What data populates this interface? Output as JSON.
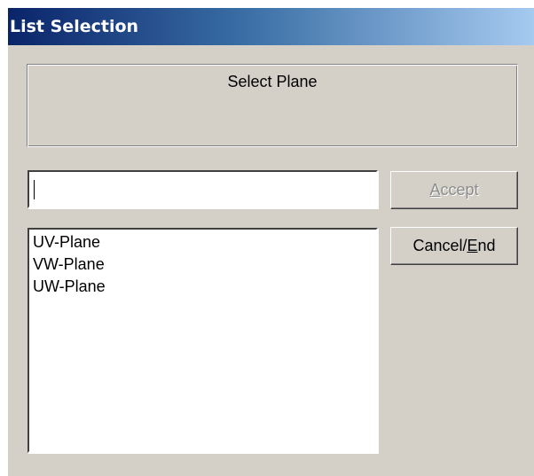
{
  "window": {
    "title": "List Selection"
  },
  "prompt": {
    "text": "Select Plane"
  },
  "input": {
    "value": ""
  },
  "list": {
    "items": [
      "UV-Plane",
      "VW-Plane",
      "UW-Plane"
    ]
  },
  "buttons": {
    "accept": {
      "mnemonic": "A",
      "rest": "ccept",
      "enabled": false
    },
    "cancel": {
      "prefix": "Cancel/",
      "mnemonic": "E",
      "rest": "nd",
      "enabled": true
    }
  },
  "colors": {
    "dialog_bg": "#d4d0c8",
    "title_gradient_start": "#0a246a",
    "title_gradient_end": "#a6caf0",
    "disabled_text": "#8c8c8c"
  }
}
